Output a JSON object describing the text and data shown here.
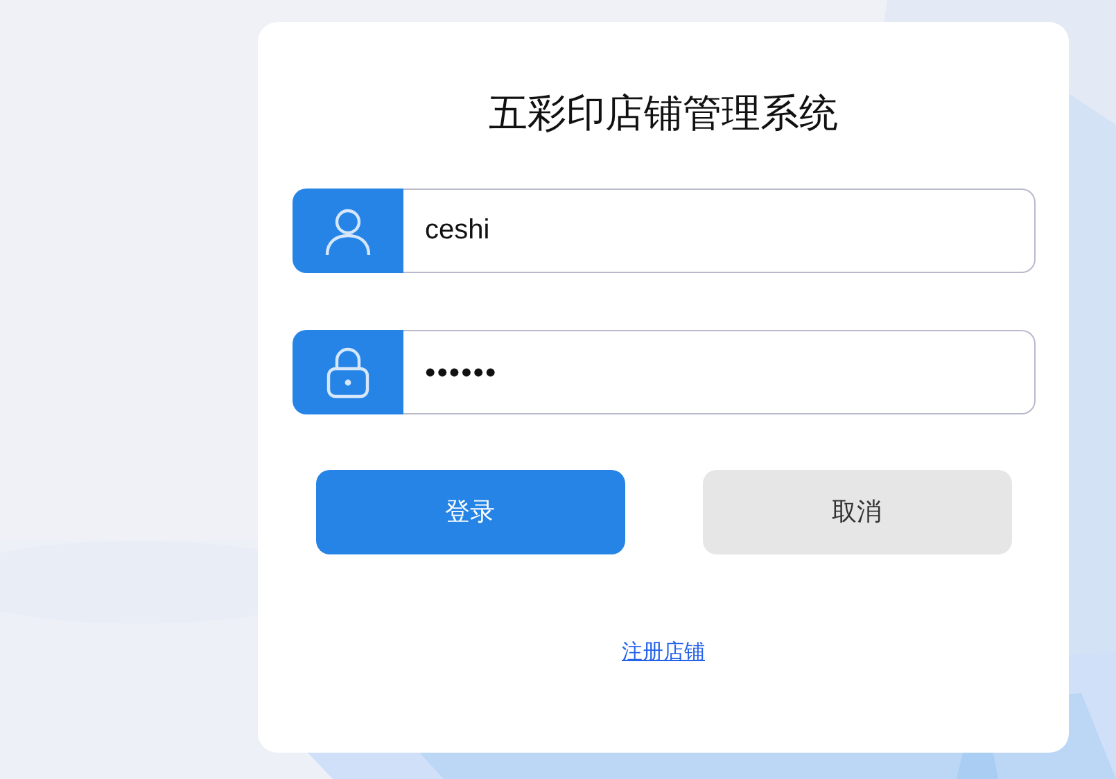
{
  "title": "五彩印店铺管理系统",
  "fields": [
    {
      "kind": "user",
      "value": "ceshi"
    },
    {
      "kind": "password",
      "value": "••••••"
    }
  ],
  "buttons": [
    {
      "label": "登录",
      "kind": "primary"
    },
    {
      "label": "取消",
      "kind": "secondary"
    }
  ],
  "register_link": "注册店铺"
}
